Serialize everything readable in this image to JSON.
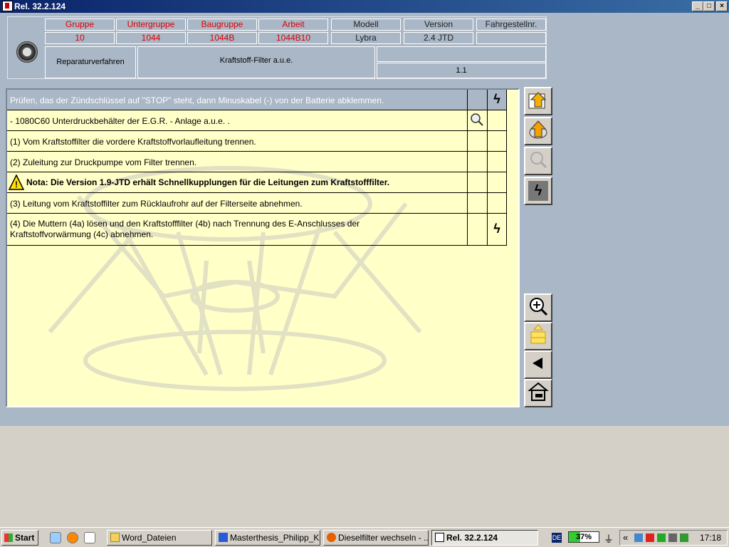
{
  "window": {
    "title": "Rel. 32.2.124",
    "buttons": {
      "minimize": "_",
      "maximize": "□",
      "close": "×"
    }
  },
  "header": {
    "columns": [
      {
        "label": "Gruppe",
        "value": "10"
      },
      {
        "label": "Untergruppe",
        "value": "1044"
      },
      {
        "label": "Baugruppe",
        "value": "1044B"
      },
      {
        "label": "Arbeit",
        "value": "1044B10"
      },
      {
        "label": "Modell",
        "value": "Lybra"
      },
      {
        "label": "Version",
        "value": "2.4 JTD"
      },
      {
        "label": "Fahrgestellnr.",
        "value": ""
      }
    ],
    "procedure_label": "Reparaturverfahren",
    "procedure_title": "Kraftstoff-Filter a.u.e.",
    "revision": "1.1"
  },
  "steps": {
    "header": "Prüfen, das der Zündschlüssel auf \"STOP\" steht, dann Minuskabel (-) von der Batterie abklemmen.",
    "rows": [
      {
        "text": "- 1080C60 Unterdruckbehälter der E.G.R. - Anlage a.u.e.  ."
      },
      {
        "text": "(1) Vom Kraftstoffilter die vordere Kraftstoffvorlaufleitung trennen."
      },
      {
        "text": "(2) Zuleitung zur Druckpumpe vom Filter trennen."
      },
      {
        "text": "Nota: Die Version 1.9-JTD erhält Schnellkupplungen für die Leitungen zum Kraftstofffilter."
      },
      {
        "text": "(3) Leitung vom Kraftstoffilter zum Rücklaufrohr auf der Filterseite abnehmen."
      },
      {
        "text": "(4) Die Muttern (4a) lösen und den Kraftstofffilter (4b) nach Trennung des E-Anschlusses der Kraftstoffvorwärmung (4c) abnehmen."
      }
    ]
  },
  "toolbar": {
    "icons": [
      "folder-up-icon",
      "bug-up-icon",
      "magnifier-icon",
      "lightning-icon",
      "zoom-in-icon",
      "stack-icon",
      "back-arrow-icon",
      "home-car-icon"
    ]
  },
  "taskbar": {
    "start_label": "Start",
    "tasks": [
      {
        "label": "Word_Dateien"
      },
      {
        "label": "Masterthesis_Philipp_K..."
      },
      {
        "label": "Dieselfilter wechseln - ..."
      },
      {
        "label": "Rel. 32.2.124"
      }
    ],
    "language": "DE",
    "battery": "37%",
    "battery_fraction": 0.37,
    "clock": "17:18"
  }
}
